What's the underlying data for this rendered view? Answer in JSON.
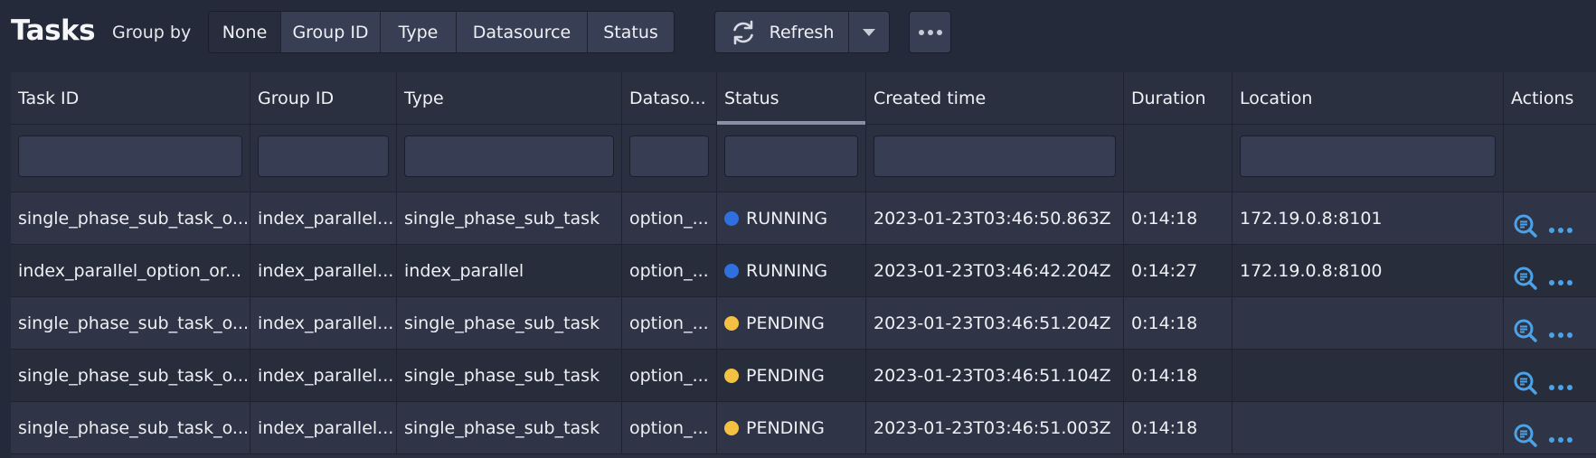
{
  "page": {
    "title": "Tasks"
  },
  "toolbar": {
    "group_by_label": "Group by",
    "group_options": [
      "None",
      "Group ID",
      "Type",
      "Datasource",
      "Status"
    ],
    "selected_group": "None",
    "refresh_label": "Refresh"
  },
  "table": {
    "columns": [
      "Task ID",
      "Group ID",
      "Type",
      "Dataso...",
      "Status",
      "Created time",
      "Duration",
      "Location",
      "Actions"
    ],
    "sorted_column": "Status",
    "rows": [
      {
        "task_id": "single_phase_sub_task_o...",
        "group_id": "index_parallel...",
        "type": "single_phase_sub_task",
        "datasource": "option_...",
        "status": "RUNNING",
        "created_time": "2023-01-23T03:46:50.863Z",
        "duration": "0:14:18",
        "location": "172.19.0.8:8101"
      },
      {
        "task_id": "index_parallel_option_or...",
        "group_id": "index_parallel...",
        "type": "index_parallel",
        "datasource": "option_...",
        "status": "RUNNING",
        "created_time": "2023-01-23T03:46:42.204Z",
        "duration": "0:14:27",
        "location": "172.19.0.8:8100"
      },
      {
        "task_id": "single_phase_sub_task_o...",
        "group_id": "index_parallel...",
        "type": "single_phase_sub_task",
        "datasource": "option_...",
        "status": "PENDING",
        "created_time": "2023-01-23T03:46:51.204Z",
        "duration": "0:14:18",
        "location": ""
      },
      {
        "task_id": "single_phase_sub_task_o...",
        "group_id": "index_parallel...",
        "type": "single_phase_sub_task",
        "datasource": "option_...",
        "status": "PENDING",
        "created_time": "2023-01-23T03:46:51.104Z",
        "duration": "0:14:18",
        "location": ""
      },
      {
        "task_id": "single_phase_sub_task_o...",
        "group_id": "index_parallel...",
        "type": "single_phase_sub_task",
        "datasource": "option_...",
        "status": "PENDING",
        "created_time": "2023-01-23T03:46:51.003Z",
        "duration": "0:14:18",
        "location": ""
      }
    ]
  },
  "colors": {
    "running": "#2f6fe0",
    "pending": "#f5c142",
    "action_icon": "#4aa3e8"
  },
  "icons": {
    "refresh": "refresh-icon",
    "dropdown": "caret-down-icon",
    "more": "more-icon",
    "view": "magnifier-icon",
    "row_more": "more-icon"
  }
}
